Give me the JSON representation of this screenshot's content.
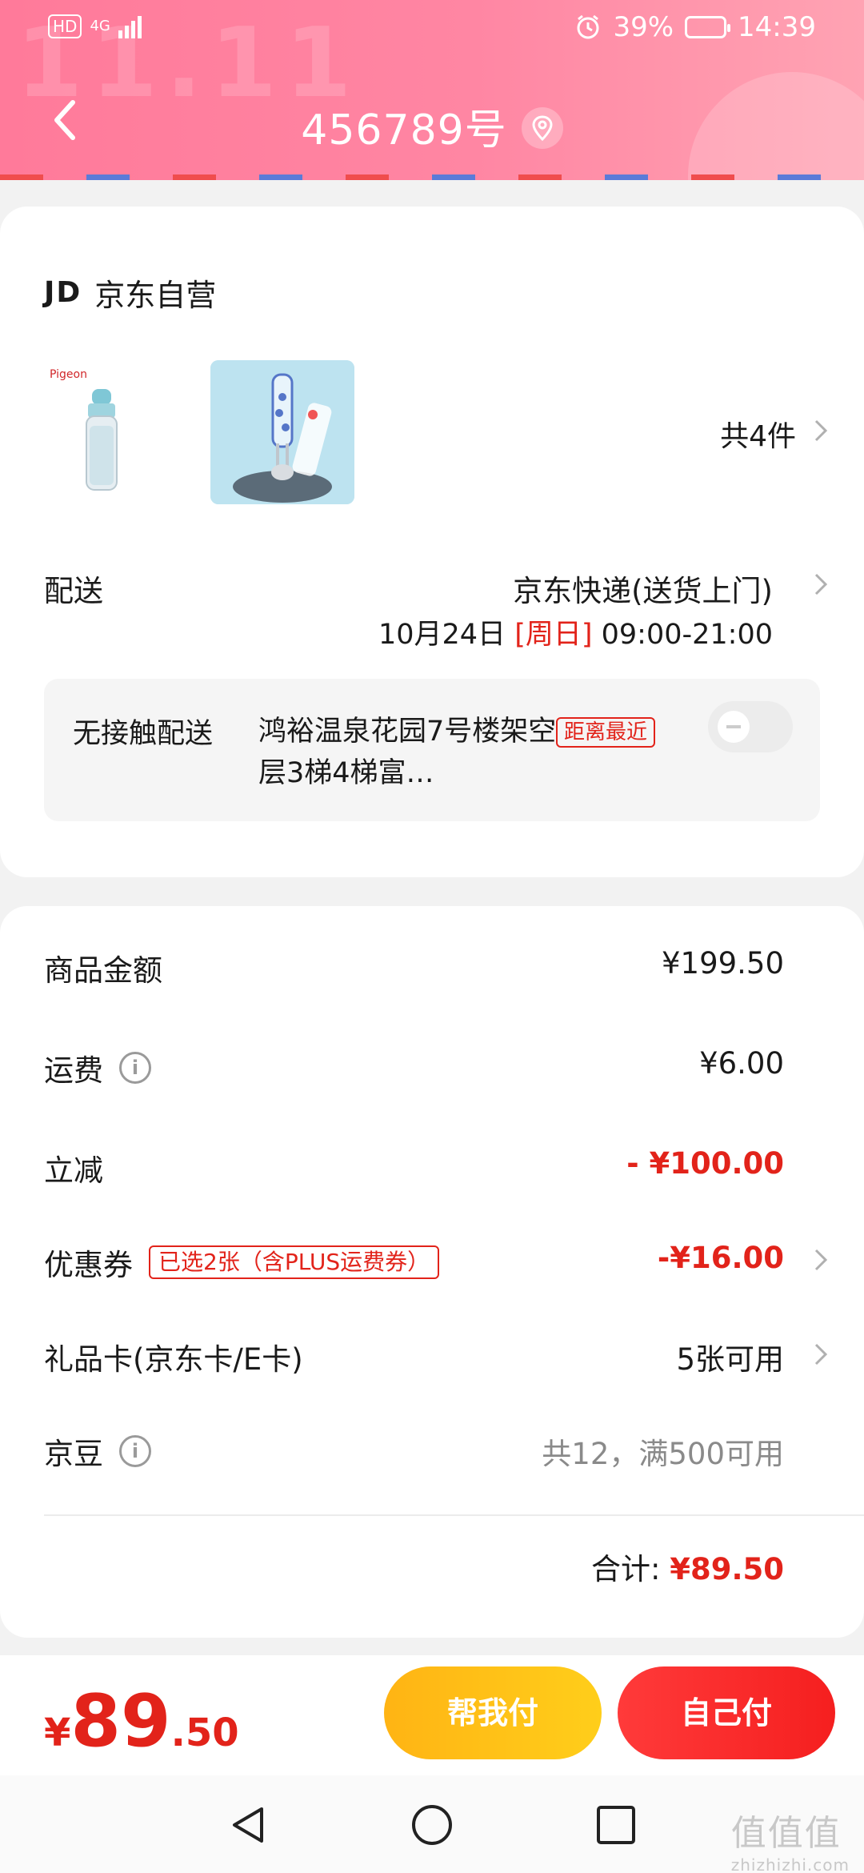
{
  "status_bar": {
    "hd": "HD",
    "network": "4G",
    "battery_percent": "39%",
    "time": "14:39"
  },
  "header": {
    "title": "456789号"
  },
  "shop": {
    "logo": "JD",
    "name": "京东自营"
  },
  "products": {
    "count_label": "共4件",
    "brand_text": "Pigeon"
  },
  "shipping": {
    "label": "配送",
    "method": "京东快递(送货上门)",
    "date": "10月24日",
    "day": "[周日]",
    "time_range": "09:00-21:00"
  },
  "contactless": {
    "label": "无接触配送",
    "address": "鸿裕温泉花园7号楼架空层3梯4梯富…",
    "badge": "距离最近",
    "enabled": false
  },
  "summary": {
    "goods_amount_label": "商品金额",
    "goods_amount": "¥199.50",
    "shipping_fee_label": "运费",
    "shipping_fee": "¥6.00",
    "instant_discount_label": "立减",
    "instant_discount": "- ¥100.00",
    "coupon_label": "优惠券",
    "coupon_tag": "已选2张（含PLUS运费券）",
    "coupon_value": "-¥16.00",
    "gift_card_label": "礼品卡(京东卡/E卡)",
    "gift_card_value": "5张可用",
    "jd_beans_label": "京豆",
    "jd_beans_value": "共12，满500可用",
    "total_label": "合计:",
    "total_amount": "¥89.50"
  },
  "bottom_bar": {
    "currency": "¥",
    "price_int": "89",
    "price_dec": ".50",
    "help_pay_label": "帮我付",
    "self_pay_label": "自己付"
  },
  "watermark": {
    "text": "值值值",
    "sub": "zhizhizhi.com"
  },
  "colors": {
    "accent_red": "#e2231a",
    "header_pink": "#ff86a3",
    "help_btn": "#ffc114",
    "self_btn": "#f52a2a"
  }
}
